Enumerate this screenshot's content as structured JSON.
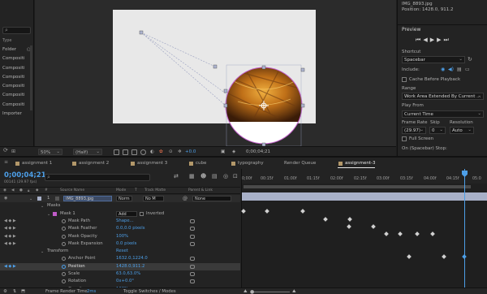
{
  "project_panel": {
    "type_header": "Type",
    "types": [
      "Folder",
      "Compositi",
      "Compositi",
      "Compositi",
      "Compositi",
      "Compositi",
      "Compositi",
      "Importer"
    ]
  },
  "viewer_footer": {
    "zoom": "50%",
    "resolution": "(Half)",
    "exposure": "+0.0",
    "timecode": "0;00;04;21"
  },
  "info_panel": {
    "file_name": "IMG_8893.jpg",
    "position": "Position: 1428.0, 911.2"
  },
  "preview_panel": {
    "title": "Preview",
    "shortcut_label": "Shortcut",
    "shortcut_value": "Spacebar",
    "include_label": "Include:",
    "cache_before_playback": "Cache Before Playback",
    "range_label": "Range",
    "range_value": "Work Area Extended By Current ...",
    "play_from_label": "Play From",
    "play_from_value": "Current Time",
    "frame_rate_label": "Frame Rate",
    "frame_rate_value": "(29.97)",
    "skip_label": "Skip",
    "skip_value": "0",
    "resolution_label": "Resolution",
    "resolution_value": "Auto",
    "full_screen": "Full Screen",
    "on_stop": "On (Spacebar) Stop:"
  },
  "timeline": {
    "tabs": [
      "assignment 1",
      "assignment 2",
      "assignment 3",
      "cube",
      "typography",
      "Render Queue",
      "assignment-3"
    ],
    "active_tab_index": 6,
    "current_time": "0;00;04;21",
    "fps_note": "00141 (29.97 fps)",
    "columns": {
      "source_name": "Source Name",
      "mode": "Mode",
      "t": "T",
      "track_matte": "Track Matte",
      "parent": "Parent & Link"
    },
    "layer": {
      "number": "1",
      "name": "IMG_8893.jpg",
      "mode": "Norm",
      "track_matte": "No M",
      "parent": "None"
    },
    "masks_label": "Masks",
    "mask1": {
      "name": "Mask 1",
      "mode": "Add",
      "inverted": "Inverted"
    },
    "mask_props": [
      {
        "name": "Mask Path",
        "value": "Shape..."
      },
      {
        "name": "Mask Feather",
        "value": "0.0,0.0 pixels"
      },
      {
        "name": "Mask Opacity",
        "value": "100%"
      },
      {
        "name": "Mask Expansion",
        "value": "0.0 pixels"
      }
    ],
    "transform_label": "Transform",
    "transform_reset": "Reset",
    "transform_props": [
      {
        "name": "Anchor Point",
        "value": "1632.0,1224.0"
      },
      {
        "name": "Position",
        "value": "1428.0,911.2"
      },
      {
        "name": "Scale",
        "value": "63.0,63.0%"
      },
      {
        "name": "Rotation",
        "value": "0x+0.0°"
      },
      {
        "name": "Opacity",
        "value": "100%"
      }
    ],
    "ruler_ticks": [
      "0;00f",
      "00:15f",
      "01:00f",
      "01:15f",
      "02:00f",
      "02:15f",
      "03:00f",
      "03:15f",
      "04:00f",
      "04:15f",
      "05:0"
    ],
    "footer_left": "Frame Render Time",
    "footer_time": "2ms",
    "footer_toggle": "Toggle Switches / Modes"
  },
  "colors": {
    "accent": "#4d9fe8",
    "layer_bar": "#a8b0c8",
    "mask_outline": "#c05cc8",
    "comp_bg": "#e8e8e8"
  }
}
